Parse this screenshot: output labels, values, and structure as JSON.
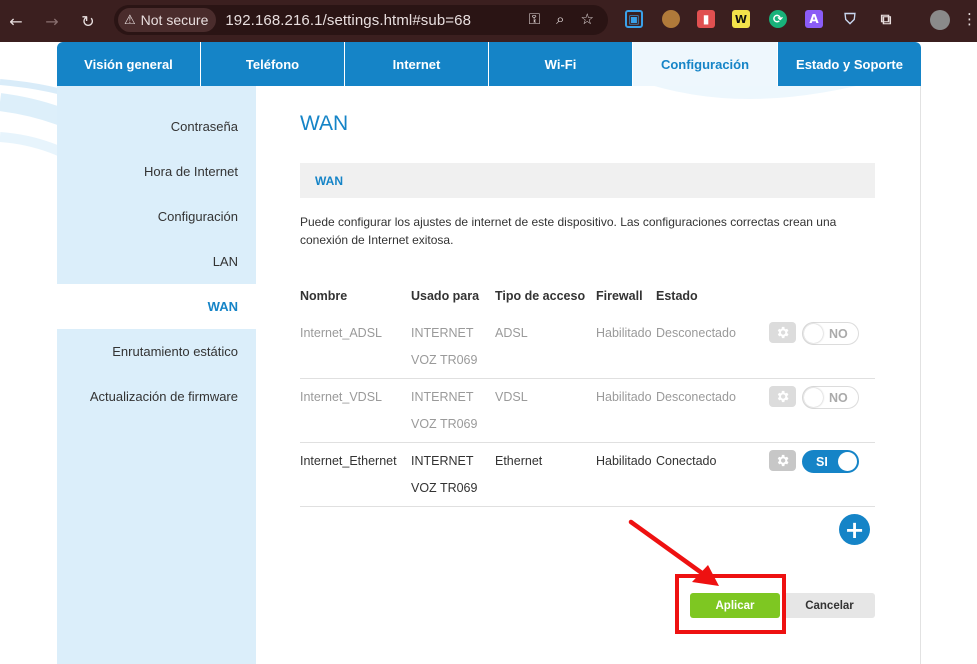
{
  "browser": {
    "security_label": "Not secure",
    "url": "192.168.216.1/settings.html#sub=68"
  },
  "tabs": [
    {
      "label": "Visión general"
    },
    {
      "label": "Teléfono"
    },
    {
      "label": "Internet"
    },
    {
      "label": "Wi-Fi"
    },
    {
      "label": "Configuración"
    },
    {
      "label": "Estado y Soporte"
    }
  ],
  "sidebar": {
    "items": [
      {
        "label": "Contraseña"
      },
      {
        "label": "Hora de Internet"
      },
      {
        "label": "Configuración"
      },
      {
        "label": "LAN"
      },
      {
        "label": "WAN"
      },
      {
        "label": "Enrutamiento estático"
      },
      {
        "label": "Actualización de firmware"
      }
    ]
  },
  "main": {
    "title": "WAN",
    "section_title": "WAN",
    "description": "Puede configurar los ajustes de internet de este dispositivo. Las configuraciones correctas crean una conexión de Internet exitosa.",
    "columns": [
      "Nombre",
      "Usado para",
      "Tipo de acceso",
      "Firewall",
      "Estado"
    ],
    "rows": [
      {
        "name": "Internet_ADSL",
        "used_for_1": "INTERNET",
        "used_for_2": "VOZ TR069",
        "access": "ADSL",
        "firewall": "Habilitado",
        "status": "Desconectado",
        "toggle": "NO"
      },
      {
        "name": "Internet_VDSL",
        "used_for_1": "INTERNET",
        "used_for_2": "VOZ TR069",
        "access": "VDSL",
        "firewall": "Habilitado",
        "status": "Desconectado",
        "toggle": "NO"
      },
      {
        "name": "Internet_Ethernet",
        "used_for_1": "INTERNET",
        "used_for_2": "VOZ TR069",
        "access": "Ethernet",
        "firewall": "Habilitado",
        "status": "Conectado",
        "toggle": "SI"
      }
    ],
    "add_label": "+",
    "apply_label": "Aplicar",
    "cancel_label": "Cancelar"
  },
  "colors": {
    "brand": "#1584c7",
    "apply": "#7ec722",
    "highlight": "#ee1111",
    "chrome": "#3b1f1f"
  }
}
